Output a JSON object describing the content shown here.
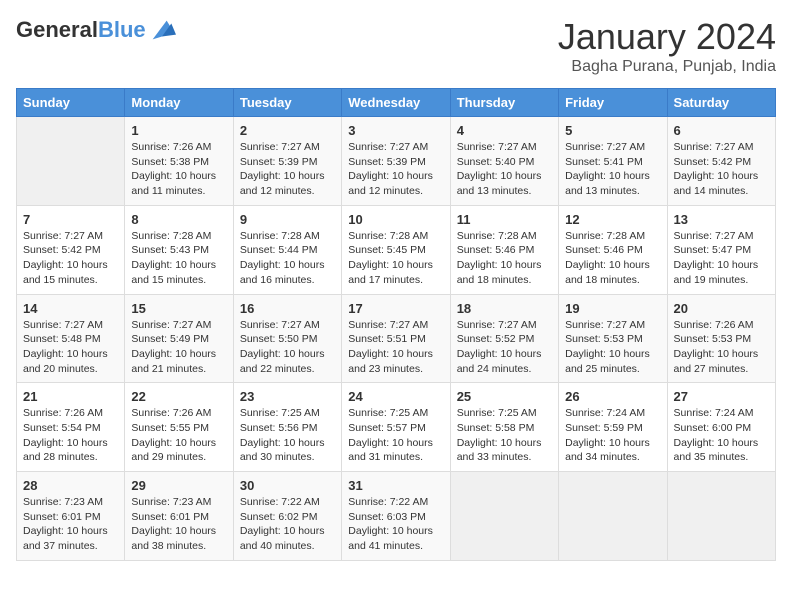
{
  "logo": {
    "line1": "General",
    "line2": "Blue"
  },
  "title": "January 2024",
  "location": "Bagha Purana, Punjab, India",
  "days_of_week": [
    "Sunday",
    "Monday",
    "Tuesday",
    "Wednesday",
    "Thursday",
    "Friday",
    "Saturday"
  ],
  "weeks": [
    [
      {
        "day": "",
        "sunrise": "",
        "sunset": "",
        "daylight": ""
      },
      {
        "day": "1",
        "sunrise": "Sunrise: 7:26 AM",
        "sunset": "Sunset: 5:38 PM",
        "daylight": "Daylight: 10 hours and 11 minutes."
      },
      {
        "day": "2",
        "sunrise": "Sunrise: 7:27 AM",
        "sunset": "Sunset: 5:39 PM",
        "daylight": "Daylight: 10 hours and 12 minutes."
      },
      {
        "day": "3",
        "sunrise": "Sunrise: 7:27 AM",
        "sunset": "Sunset: 5:39 PM",
        "daylight": "Daylight: 10 hours and 12 minutes."
      },
      {
        "day": "4",
        "sunrise": "Sunrise: 7:27 AM",
        "sunset": "Sunset: 5:40 PM",
        "daylight": "Daylight: 10 hours and 13 minutes."
      },
      {
        "day": "5",
        "sunrise": "Sunrise: 7:27 AM",
        "sunset": "Sunset: 5:41 PM",
        "daylight": "Daylight: 10 hours and 13 minutes."
      },
      {
        "day": "6",
        "sunrise": "Sunrise: 7:27 AM",
        "sunset": "Sunset: 5:42 PM",
        "daylight": "Daylight: 10 hours and 14 minutes."
      }
    ],
    [
      {
        "day": "7",
        "sunrise": "Sunrise: 7:27 AM",
        "sunset": "Sunset: 5:42 PM",
        "daylight": "Daylight: 10 hours and 15 minutes."
      },
      {
        "day": "8",
        "sunrise": "Sunrise: 7:28 AM",
        "sunset": "Sunset: 5:43 PM",
        "daylight": "Daylight: 10 hours and 15 minutes."
      },
      {
        "day": "9",
        "sunrise": "Sunrise: 7:28 AM",
        "sunset": "Sunset: 5:44 PM",
        "daylight": "Daylight: 10 hours and 16 minutes."
      },
      {
        "day": "10",
        "sunrise": "Sunrise: 7:28 AM",
        "sunset": "Sunset: 5:45 PM",
        "daylight": "Daylight: 10 hours and 17 minutes."
      },
      {
        "day": "11",
        "sunrise": "Sunrise: 7:28 AM",
        "sunset": "Sunset: 5:46 PM",
        "daylight": "Daylight: 10 hours and 18 minutes."
      },
      {
        "day": "12",
        "sunrise": "Sunrise: 7:28 AM",
        "sunset": "Sunset: 5:46 PM",
        "daylight": "Daylight: 10 hours and 18 minutes."
      },
      {
        "day": "13",
        "sunrise": "Sunrise: 7:27 AM",
        "sunset": "Sunset: 5:47 PM",
        "daylight": "Daylight: 10 hours and 19 minutes."
      }
    ],
    [
      {
        "day": "14",
        "sunrise": "Sunrise: 7:27 AM",
        "sunset": "Sunset: 5:48 PM",
        "daylight": "Daylight: 10 hours and 20 minutes."
      },
      {
        "day": "15",
        "sunrise": "Sunrise: 7:27 AM",
        "sunset": "Sunset: 5:49 PM",
        "daylight": "Daylight: 10 hours and 21 minutes."
      },
      {
        "day": "16",
        "sunrise": "Sunrise: 7:27 AM",
        "sunset": "Sunset: 5:50 PM",
        "daylight": "Daylight: 10 hours and 22 minutes."
      },
      {
        "day": "17",
        "sunrise": "Sunrise: 7:27 AM",
        "sunset": "Sunset: 5:51 PM",
        "daylight": "Daylight: 10 hours and 23 minutes."
      },
      {
        "day": "18",
        "sunrise": "Sunrise: 7:27 AM",
        "sunset": "Sunset: 5:52 PM",
        "daylight": "Daylight: 10 hours and 24 minutes."
      },
      {
        "day": "19",
        "sunrise": "Sunrise: 7:27 AM",
        "sunset": "Sunset: 5:53 PM",
        "daylight": "Daylight: 10 hours and 25 minutes."
      },
      {
        "day": "20",
        "sunrise": "Sunrise: 7:26 AM",
        "sunset": "Sunset: 5:53 PM",
        "daylight": "Daylight: 10 hours and 27 minutes."
      }
    ],
    [
      {
        "day": "21",
        "sunrise": "Sunrise: 7:26 AM",
        "sunset": "Sunset: 5:54 PM",
        "daylight": "Daylight: 10 hours and 28 minutes."
      },
      {
        "day": "22",
        "sunrise": "Sunrise: 7:26 AM",
        "sunset": "Sunset: 5:55 PM",
        "daylight": "Daylight: 10 hours and 29 minutes."
      },
      {
        "day": "23",
        "sunrise": "Sunrise: 7:25 AM",
        "sunset": "Sunset: 5:56 PM",
        "daylight": "Daylight: 10 hours and 30 minutes."
      },
      {
        "day": "24",
        "sunrise": "Sunrise: 7:25 AM",
        "sunset": "Sunset: 5:57 PM",
        "daylight": "Daylight: 10 hours and 31 minutes."
      },
      {
        "day": "25",
        "sunrise": "Sunrise: 7:25 AM",
        "sunset": "Sunset: 5:58 PM",
        "daylight": "Daylight: 10 hours and 33 minutes."
      },
      {
        "day": "26",
        "sunrise": "Sunrise: 7:24 AM",
        "sunset": "Sunset: 5:59 PM",
        "daylight": "Daylight: 10 hours and 34 minutes."
      },
      {
        "day": "27",
        "sunrise": "Sunrise: 7:24 AM",
        "sunset": "Sunset: 6:00 PM",
        "daylight": "Daylight: 10 hours and 35 minutes."
      }
    ],
    [
      {
        "day": "28",
        "sunrise": "Sunrise: 7:23 AM",
        "sunset": "Sunset: 6:01 PM",
        "daylight": "Daylight: 10 hours and 37 minutes."
      },
      {
        "day": "29",
        "sunrise": "Sunrise: 7:23 AM",
        "sunset": "Sunset: 6:01 PM",
        "daylight": "Daylight: 10 hours and 38 minutes."
      },
      {
        "day": "30",
        "sunrise": "Sunrise: 7:22 AM",
        "sunset": "Sunset: 6:02 PM",
        "daylight": "Daylight: 10 hours and 40 minutes."
      },
      {
        "day": "31",
        "sunrise": "Sunrise: 7:22 AM",
        "sunset": "Sunset: 6:03 PM",
        "daylight": "Daylight: 10 hours and 41 minutes."
      },
      {
        "day": "",
        "sunrise": "",
        "sunset": "",
        "daylight": ""
      },
      {
        "day": "",
        "sunrise": "",
        "sunset": "",
        "daylight": ""
      },
      {
        "day": "",
        "sunrise": "",
        "sunset": "",
        "daylight": ""
      }
    ]
  ]
}
